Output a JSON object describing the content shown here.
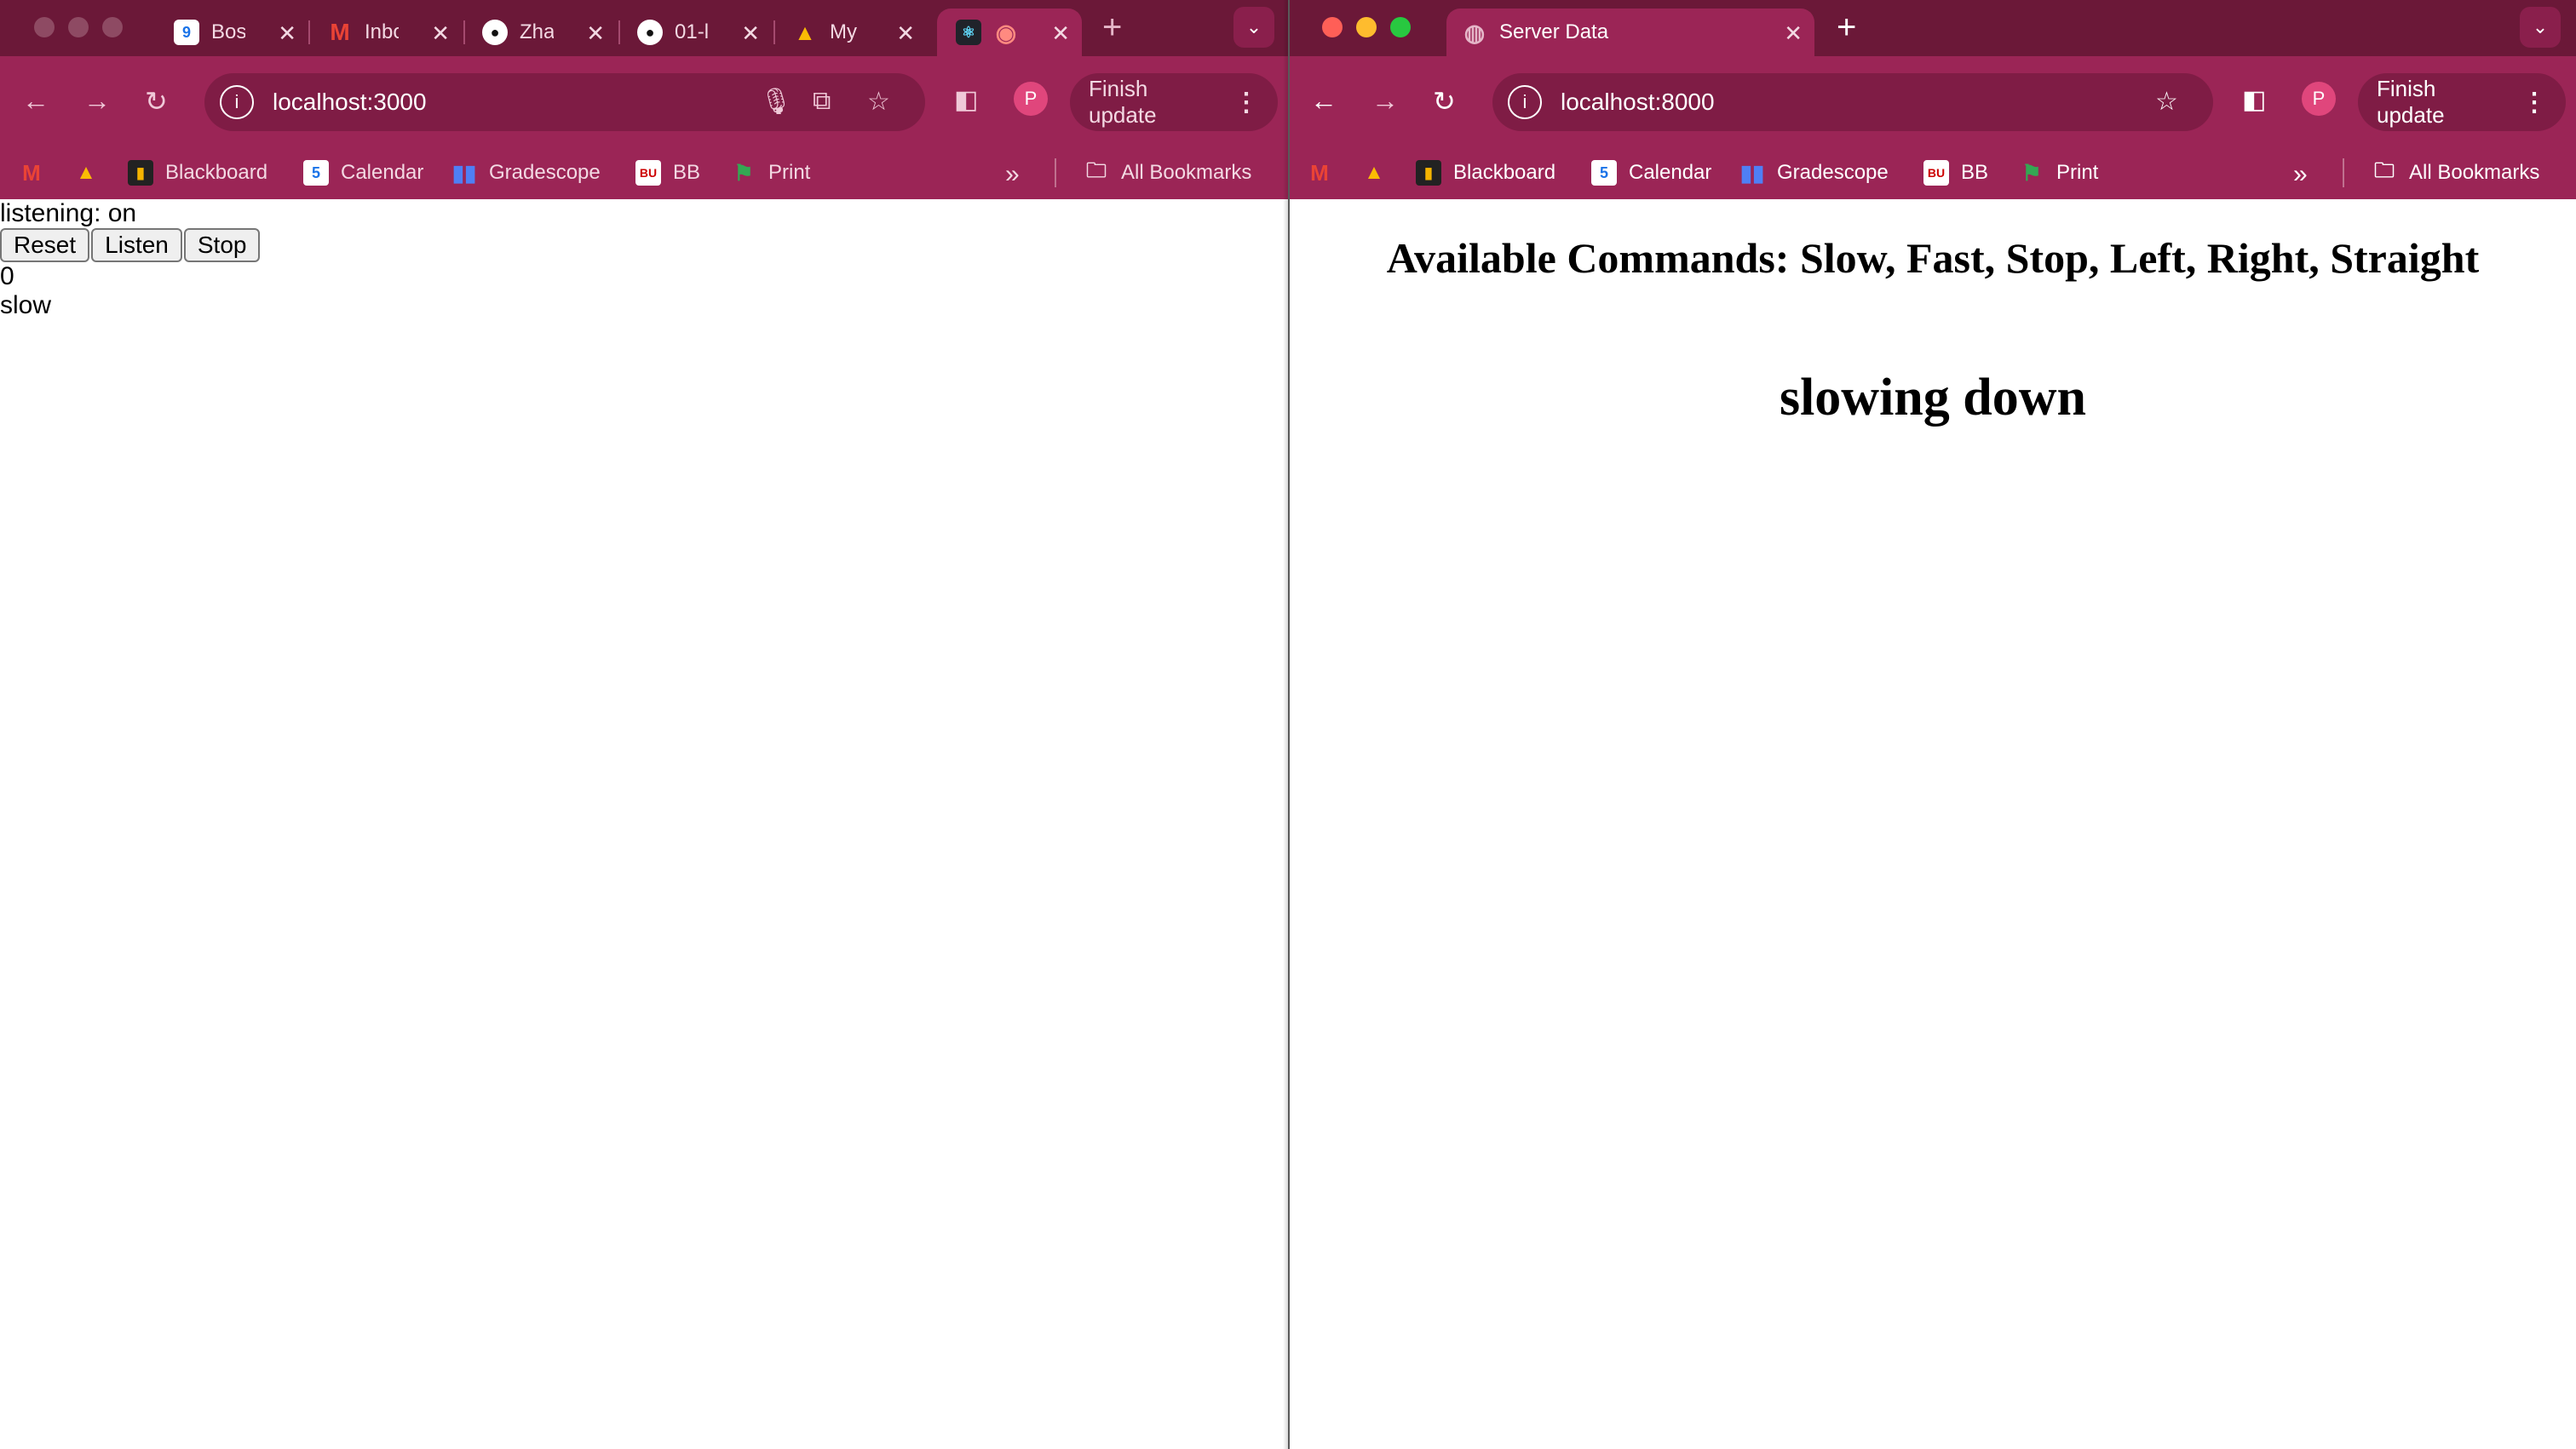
{
  "left_window": {
    "tabs": [
      {
        "title": "Bos",
        "icon": "google-calendar-icon"
      },
      {
        "title": "Inbo",
        "icon": "gmail-icon"
      },
      {
        "title": "Zha",
        "icon": "github-icon"
      },
      {
        "title": "01-l",
        "icon": "github-icon"
      },
      {
        "title": "My",
        "icon": "google-drive-icon"
      },
      {
        "title": "",
        "icon": "react-icon",
        "active": true
      }
    ],
    "url": "localhost:3000",
    "finish_update": "Finish update",
    "profile_initial": "P",
    "bookmarks": [
      "Blackboard",
      "Calendar",
      "Gradescope",
      "BB",
      "Print"
    ],
    "all_bookmarks": "All Bookmarks",
    "page": {
      "listening": "listening: on",
      "buttons": {
        "reset": "Reset",
        "listen": "Listen",
        "stop": "Stop"
      },
      "count": "0",
      "transcript": "slow"
    }
  },
  "right_window": {
    "tab_title": "Server Data",
    "url": "localhost:8000",
    "finish_update": "Finish update",
    "profile_initial": "P",
    "bookmarks": [
      "Blackboard",
      "Calendar",
      "Gradescope",
      "BB",
      "Print"
    ],
    "all_bookmarks": "All Bookmarks",
    "page": {
      "commands_heading": "Available Commands: Slow, Fast, Stop, Left, Right, Straight",
      "status": "slowing down"
    }
  }
}
